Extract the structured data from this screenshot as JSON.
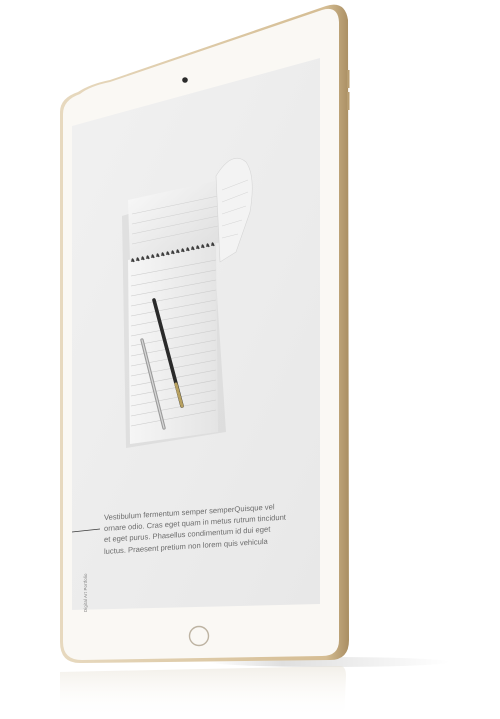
{
  "device": {
    "frame_color": "#d9c6a4",
    "bezel_color": "#faf8f4",
    "screen_color": "#ececec"
  },
  "screen": {
    "image_description_icon": "notepad-with-pens-icon",
    "body_text": "Vestibulum fermentum semper semperQuisque vel ornare odio. Cras eget quam in metus rutrum tincidunt et eget purus. Phasellus condimentum id dui eget luctus. Praesent pretium non lorem quis vehicula",
    "side_caption": "Digital Art Portfolio"
  }
}
